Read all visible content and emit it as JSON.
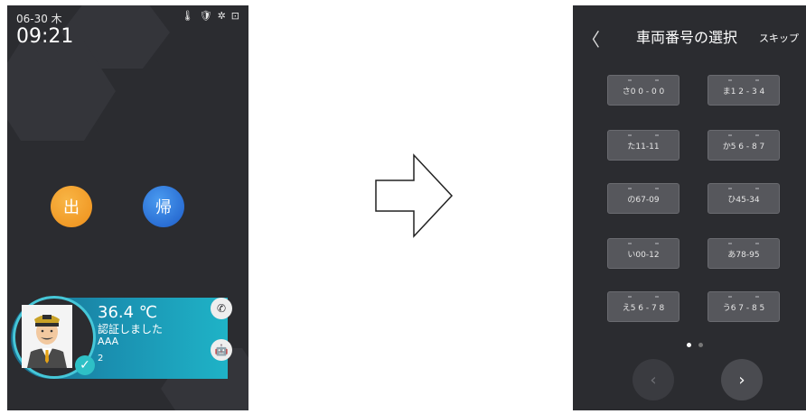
{
  "left": {
    "date": "06-30 木",
    "time": "09:21",
    "status_icons": [
      "🌡",
      "🛡",
      "✲",
      "⊡"
    ],
    "buttons": {
      "out": "出",
      "back": "帰"
    },
    "auth": {
      "temperature": "36.4 ℃",
      "message": "認証しました",
      "name": "AAA",
      "number": "2"
    },
    "side_icons": {
      "phone": "✆",
      "robot": "🤖"
    }
  },
  "right": {
    "back": "〈",
    "title": "車両番号の選択",
    "skip": "スキップ",
    "plates": [
      "さ0 0 - 0 0",
      "ま1 2 - 3 4",
      "た11-11",
      "か5 6 - 8 7",
      "の67-09",
      "ひ45-34",
      "い00-12",
      "あ78-95",
      "え5 6 - 7 8",
      "う6 7 - 8 5"
    ],
    "pagination": {
      "active_index": 0,
      "count": 2
    },
    "prev": "‹",
    "next": "›"
  },
  "colors": {
    "out_button": "#ee8f1a",
    "back_button": "#1d5cc8",
    "auth_card": "#1a8fb0",
    "phone_bg": "#2b2c30"
  }
}
